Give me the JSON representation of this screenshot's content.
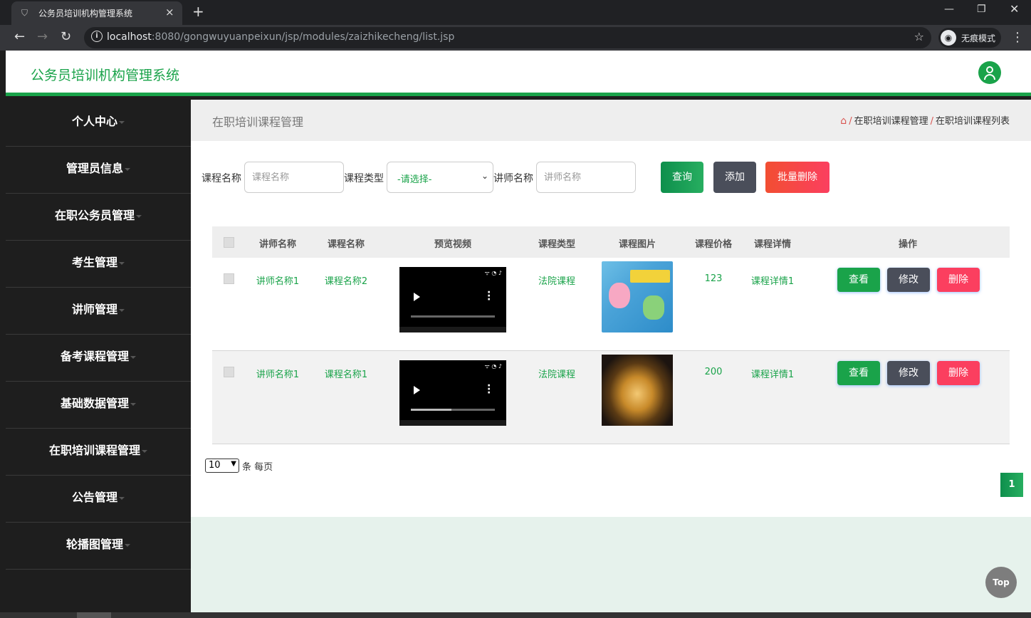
{
  "browser": {
    "tab_title": "公务员培训机构管理系统",
    "url_host": "localhost",
    "url_rest": ":8080/gongwuyuanpeixun/jsp/modules/zaizhikecheng/list.jsp",
    "incognito_label": "无痕模式",
    "new_tab": "+",
    "close": "×"
  },
  "header": {
    "title": "公务员培训机构管理系统"
  },
  "sidebar": {
    "items": [
      {
        "label": "个人中心"
      },
      {
        "label": "管理员信息"
      },
      {
        "label": "在职公务员管理"
      },
      {
        "label": "考生管理"
      },
      {
        "label": "讲师管理"
      },
      {
        "label": "备考课程管理"
      },
      {
        "label": "基础数据管理"
      },
      {
        "label": "在职培训课程管理"
      },
      {
        "label": "公告管理"
      },
      {
        "label": "轮播图管理"
      }
    ]
  },
  "page": {
    "title": "在职培训课程管理",
    "breadcrumb": [
      "在职培训课程管理",
      "在职培训课程列表"
    ]
  },
  "filters": {
    "course_name_label": "课程名称",
    "course_name_placeholder": "课程名称",
    "course_type_label": "课程类型",
    "course_type_value": "-请选择-",
    "teacher_name_label": "讲师名称",
    "teacher_name_placeholder": "讲师名称",
    "search_label": "查询",
    "add_label": "添加",
    "batch_delete_label": "批量删除"
  },
  "table": {
    "headers": [
      "讲师名称",
      "课程名称",
      "预览视频",
      "课程类型",
      "课程图片",
      "课程价格",
      "课程详情",
      "操作"
    ],
    "rows": [
      {
        "teacher": "讲师名称1",
        "course": "课程名称2",
        "type": "法院课程",
        "price": "123",
        "detail": "课程详情1",
        "image": "peppa-pig-book-box",
        "video_progress": 0.0
      },
      {
        "teacher": "讲师名称1",
        "course": "课程名称1",
        "type": "法院课程",
        "price": "200",
        "detail": "课程详情1",
        "image": "golden-vase-lamp",
        "video_progress": 0.48
      }
    ],
    "actions": {
      "view": "查看",
      "edit": "修改",
      "delete": "删除"
    }
  },
  "pagination": {
    "page_size": "10",
    "per_page_text": "条 每页",
    "current_page": "1"
  },
  "top_button": "Top",
  "colors": {
    "brand": "#1aa34a",
    "danger": "#fb3f5f",
    "dark": "#4a4e5a"
  },
  "icons": [
    "home-icon",
    "user-avatar-icon",
    "play-icon",
    "more-vertical-icon",
    "star-icon",
    "info-icon",
    "incognito-icon"
  ]
}
